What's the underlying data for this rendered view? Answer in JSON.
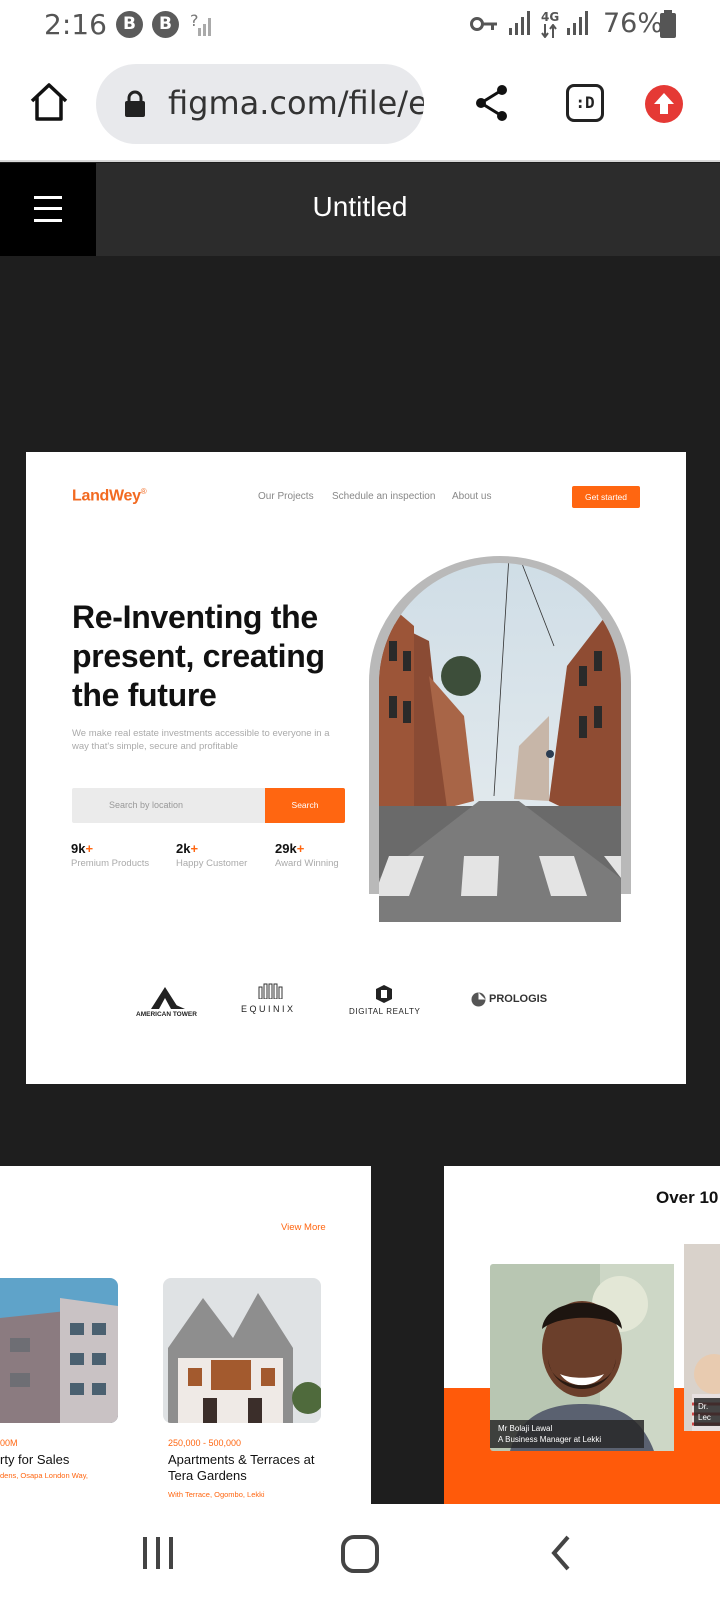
{
  "status_bar": {
    "time": "2:16",
    "notif_letters": [
      "B",
      "B"
    ],
    "network": "4G",
    "battery": "76%"
  },
  "browser": {
    "url": "figma.com/file/e",
    "tab_label": ":D"
  },
  "figma": {
    "file_title": "Untitled"
  },
  "landing": {
    "logo": "LandWey",
    "logo_mark": "®",
    "nav": [
      "Our Projects",
      "Schedule an inspection",
      "About us"
    ],
    "cta": "Get started",
    "hero_title": "Re-Inventing the present, creating the future",
    "hero_subtitle": "We make real estate investments accessible to everyone in a way that's simple, secure and profitable",
    "search_placeholder": "Search by location",
    "search_button": "Search",
    "stats": [
      {
        "value": "9k",
        "plus": "+",
        "label": "Premium Products"
      },
      {
        "value": "2k",
        "plus": "+",
        "label": "Happy Customer"
      },
      {
        "value": "29k",
        "plus": "+",
        "label": "Award Winning"
      }
    ],
    "partners": [
      "AMERICAN TOWER",
      "EQUINIX",
      "DIGITAL REALTY",
      "PROLOGIS"
    ]
  },
  "listings": {
    "view_more": "View More",
    "items": [
      {
        "price": "00M",
        "title": "rty for Sales",
        "address": "dens, Osapa London Way,"
      },
      {
        "price": "250,000 - 500,000",
        "title1": "Apartments & Terraces at",
        "title2": "Tera Gardens",
        "address": "With Terrace, Ogombo, Lekki"
      }
    ]
  },
  "testimonials": {
    "heading": "Over 10",
    "person_name": "Mr Bolaji Lawal",
    "person_role": "A Business Manager at Lekki",
    "second_name": "Dr.",
    "second_role": "Lec"
  },
  "colors": {
    "accent": "#ff6611",
    "canvas": "#1e1e1e",
    "toolbar": "#2c2c2c"
  }
}
